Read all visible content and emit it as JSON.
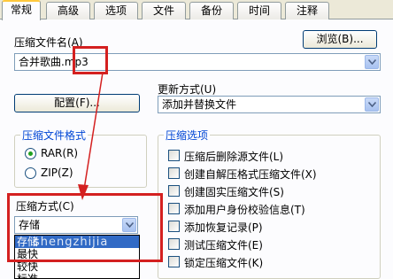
{
  "tabs": [
    {
      "label": "常规",
      "active": true
    },
    {
      "label": "高级",
      "active": false
    },
    {
      "label": "选项",
      "active": false
    },
    {
      "label": "文件",
      "active": false
    },
    {
      "label": "备份",
      "active": false
    },
    {
      "label": "时间",
      "active": false
    },
    {
      "label": "注释",
      "active": false
    }
  ],
  "archive_name": {
    "label": "压缩文件名(A)",
    "value": "合并歌曲.mp3",
    "browse_label": "浏览(B)..."
  },
  "profiles_button": "配置(F)...",
  "update_mode": {
    "label": "更新方式(U)",
    "value": "添加并替换文件"
  },
  "archive_format": {
    "title": "压缩文件格式",
    "options": [
      {
        "label": "RAR(R)",
        "checked": true
      },
      {
        "label": "ZIP(Z)",
        "checked": false
      }
    ]
  },
  "compression_method": {
    "label": "压缩方式(C)",
    "value": "存储",
    "list_items": [
      "存储",
      "最快",
      "较快",
      "标准"
    ],
    "selected_index": 0
  },
  "archive_options": {
    "title": "压缩选项",
    "items": [
      "压缩后删除源文件(L)",
      "创建自解压格式压缩文件(X)",
      "创建固实压缩文件(S)",
      "添加用户身份校验信息(T)",
      "添加恢复记录(P)",
      "测试压缩文件(E)",
      "锁定压缩文件(K)"
    ]
  },
  "watermark": "shengzhijia",
  "accent": {
    "highlight_red": "#d42020",
    "selection_blue": "#316ac5",
    "group_title_blue": "#0046d5",
    "radio_green": "#21a121"
  }
}
